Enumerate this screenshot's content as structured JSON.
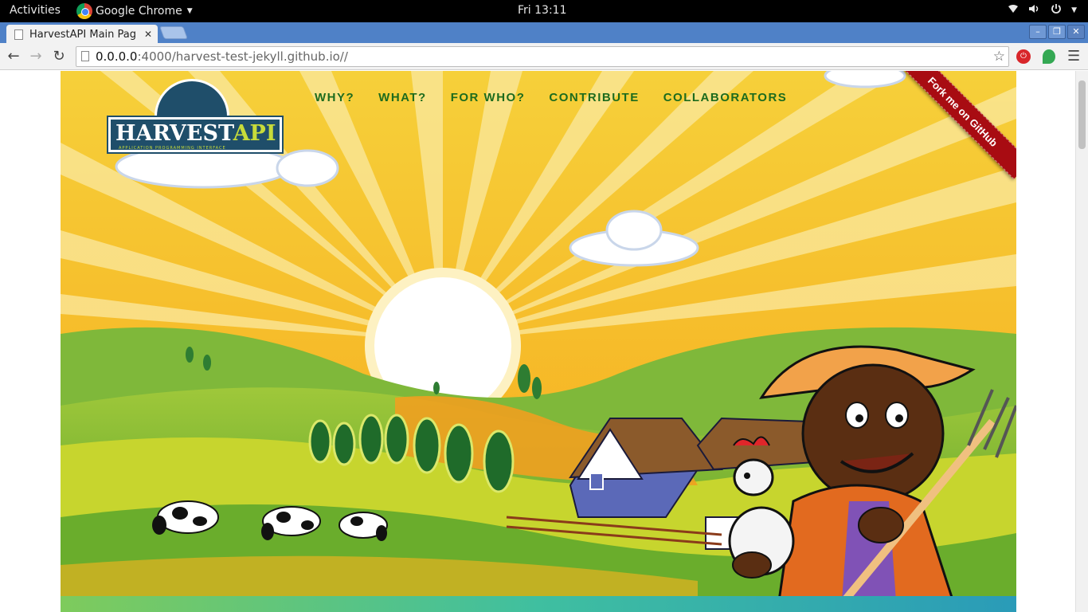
{
  "os_bar": {
    "activities": "Activities",
    "app_name": "Google Chrome",
    "clock": "Fri 13:11"
  },
  "browser": {
    "tab_title": "HarvestAPI Main Pag",
    "url_host": "0.0.0.0",
    "url_rest": ":4000/harvest-test-jekyll.github.io//"
  },
  "site": {
    "logo_main": "HARVEST",
    "logo_api": "API",
    "logo_sub": "APPLICATION PROGRAMMING INTERFACE",
    "nav": [
      "WHY?",
      "WHAT?",
      "FOR WHO?",
      "CONTRIBUTE",
      "COLLABORATORS"
    ],
    "ribbon": "Fork me on GitHub"
  },
  "colors": {
    "sky": "#f7c21d",
    "nav_text": "#1d6b1d",
    "ribbon": "#a80c12",
    "logo_bg": "#1f4e6a"
  },
  "icons": [
    "chrome-logo-icon",
    "wifi-icon",
    "volume-icon",
    "power-icon",
    "back-icon",
    "forward-icon",
    "reload-icon",
    "star-icon",
    "menu-icon"
  ]
}
